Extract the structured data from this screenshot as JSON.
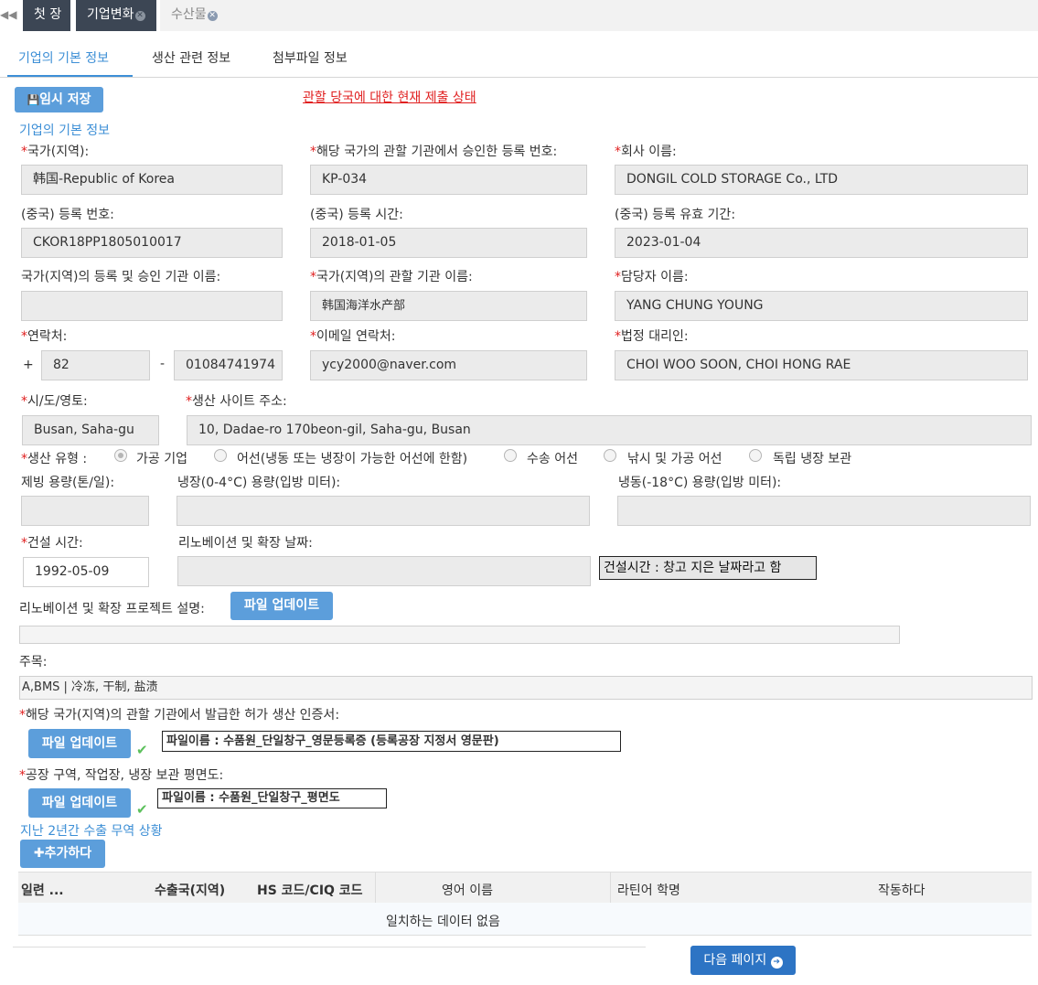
{
  "top_tabs": [
    {
      "label": "첫 장"
    },
    {
      "label": "기업변화"
    },
    {
      "label": "수산물"
    }
  ],
  "sub_tabs": [
    {
      "label": "기업의 기본 정보"
    },
    {
      "label": "생산 관련 정보"
    },
    {
      "label": "첨부파일 정보"
    }
  ],
  "toolbar": {
    "save_label": "임시 저장",
    "status_link": "관할 당국에 대한 현재 제출 상태"
  },
  "section_basic": "기업의 기본 정보",
  "fields": {
    "country_label": "국가(지역):",
    "country_value": "韩国-Republic of Korea",
    "reg_no_label": "해당 국가의 관할 기관에서 승인한 등록 번호:",
    "reg_no_value": "KP-034",
    "company_label": "회사 이름:",
    "company_value": "DONGIL COLD STORAGE Co., LTD",
    "cn_reg_no_label": "(중국) 등록 번호:",
    "cn_reg_no_value": "CKOR18PP1805010017",
    "cn_reg_time_label": "(중국) 등록 시간:",
    "cn_reg_time_value": "2018-01-05",
    "cn_reg_valid_label": "(중국) 등록 유효 기간:",
    "cn_reg_valid_value": "2023-01-04",
    "approval_org_label": "국가(지역)의 등록 및 승인 기관 이름:",
    "approval_org_value": "",
    "authority_label": "국가(지역)의 관할 기관 이름:",
    "authority_value": "韩国海洋水产部",
    "contact_person_label": "담당자 이름:",
    "contact_person_value": "YANG CHUNG YOUNG",
    "phone_label": "연락처:",
    "phone_plus": "+",
    "phone_code": "82",
    "phone_dash": "-",
    "phone_number": "01084741974",
    "email_label": "이메일 연락처:",
    "email_value": "ycy2000@naver.com",
    "legal_rep_label": "법정 대리인:",
    "legal_rep_value": "CHOI WOO SOON, CHOI HONG RAE",
    "city_label": "시/도/영토:",
    "city_value": "Busan, Saha-gu",
    "site_addr_label": "생산 사이트 주소:",
    "site_addr_value": "10, Dadae-ro 170beon-gil, Saha-gu, Busan",
    "prod_type_label": "생산 유형 :",
    "prod_types": [
      "가공 기업",
      "어선(냉동 또는 냉장이 가능한 어선에 한함)",
      "수송 어선",
      "낚시 및 가공 어선",
      "독립 냉장 보관"
    ],
    "prod_type_selected": "가공 기업",
    "ice_label": "제빙 용량(톤/일):",
    "chill_label": "냉장(0-4°C) 용량(입방 미터):",
    "freeze_label": "냉동(-18°C) 용량(입방 미터):",
    "build_time_label": "건설 시간:",
    "build_time_value": "1992-05-09",
    "renov_date_label": "리노베이션 및 확장 날짜:",
    "renov_date_value": "",
    "build_note": "건설시간 : 창고 지은 날짜라고 함",
    "renov_desc_label": "리노베이션 및 확장 프로젝트 설명:",
    "upload_label": "파일 업데이트",
    "subject_label": "주목:",
    "subject_value": "A,BMS | 冷冻, 干制, 盐渍",
    "cert_label": "해당 국가(지역)의 관할 기관에서 발급한 허가 생산 인증서:",
    "cert_file_note": "파일이름 : 수품원_단일창구_영문등록증 (등록공장 지정서 영문판)",
    "plan_label": "공장 구역, 작업장, 냉장 보관 평면도:",
    "plan_file_note": "파일이름 : 수품원_단일창구_평면도"
  },
  "trade": {
    "section_label": "지난 2년간 수출 무역 상황",
    "add_label": "추가하다",
    "columns": [
      "일련 ...",
      "수출국(지역)",
      "HS 코드/CIQ 코드",
      "영어 이름",
      "라틴어 학명",
      "작동하다"
    ],
    "empty_text": "일치하는 데이터 없음"
  },
  "next_label": "다음 페이지"
}
